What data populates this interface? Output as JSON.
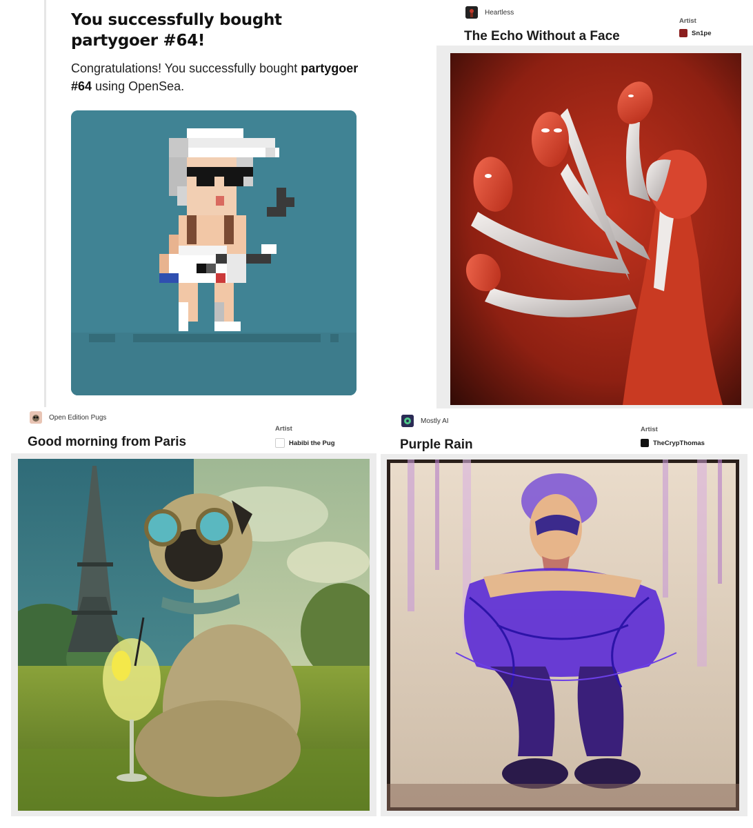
{
  "purchase": {
    "heading": "You successfully bought partygoer #64!",
    "msg_prefix": "Congratulations! You successfully bought ",
    "msg_item": "partygoer #64",
    "msg_suffix": " using OpenSea."
  },
  "cards": [
    {
      "collection": "Heartless",
      "title": "The Echo Without a Face",
      "artist_label": "Artist",
      "artist": "Sn1pe"
    },
    {
      "collection": "Open Edition Pugs",
      "title": "Good morning from Paris",
      "artist_label": "Artist",
      "artist": "Habibi the Pug"
    },
    {
      "collection": "Mostly AI",
      "title": "Purple Rain",
      "artist_label": "Artist",
      "artist": "TheCrypThomas"
    }
  ],
  "colors": {
    "nft_background": "#408394",
    "mask_red": "#d8452e",
    "purple": "#5b2bd6"
  }
}
